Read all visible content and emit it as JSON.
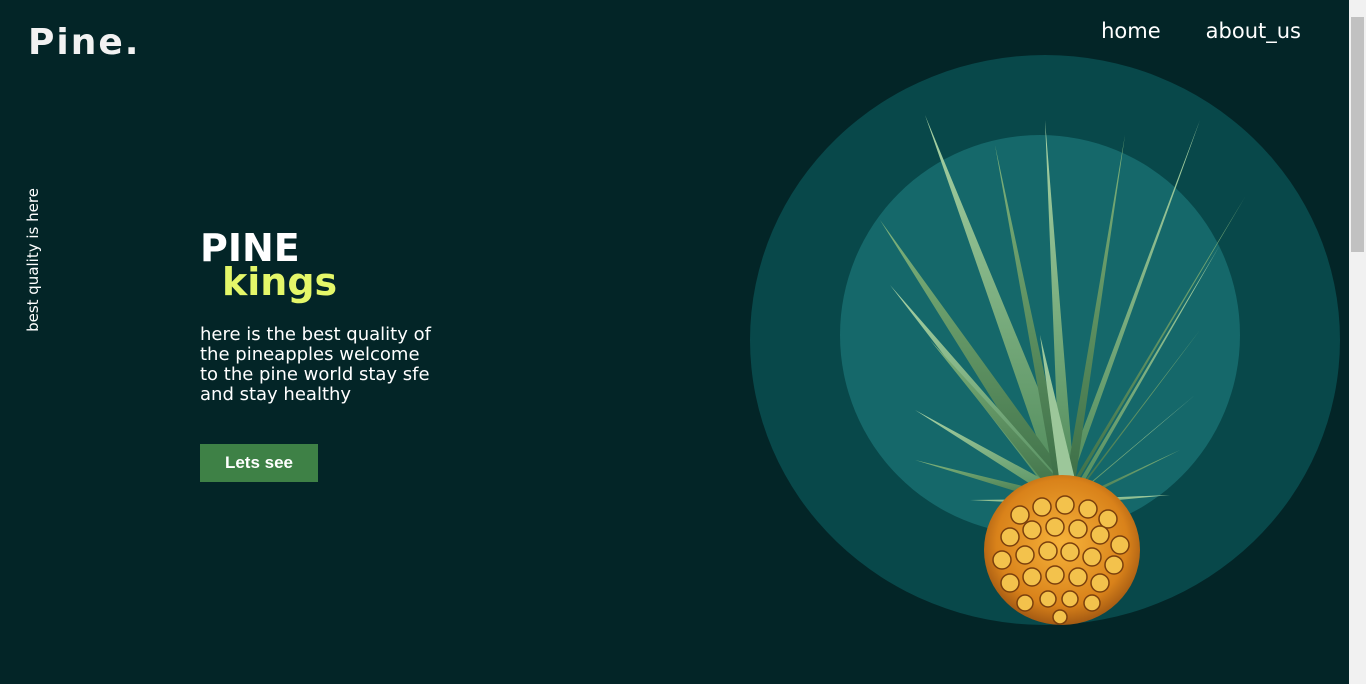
{
  "header": {
    "logo": "Pine.",
    "nav": [
      {
        "label": "home"
      },
      {
        "label": "about_us"
      }
    ]
  },
  "side_text": "best quality is here",
  "hero": {
    "title_line1": "PINE",
    "title_line2": "kings",
    "description": "here is the best quality of the pineapples welcome to the pine world stay sfe and stay healthy",
    "cta_label": "Lets see"
  },
  "colors": {
    "background": "#032527",
    "accent_yellow": "#e4f769",
    "button_green": "#3e8146",
    "circle_outer": "#08484a",
    "circle_inner": "#15686a"
  },
  "image": {
    "subject": "pineapple-image"
  }
}
